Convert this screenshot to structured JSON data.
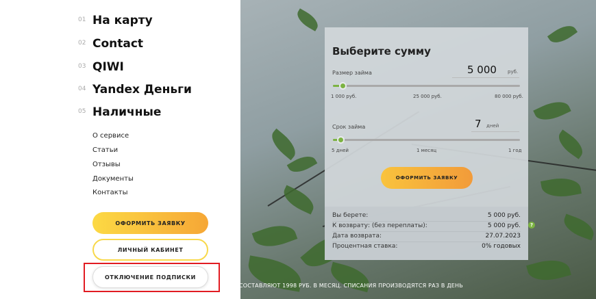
{
  "nav": {
    "items": [
      {
        "num": "01",
        "label": "На карту"
      },
      {
        "num": "02",
        "label": "Contact"
      },
      {
        "num": "03",
        "label": "QIWI"
      },
      {
        "num": "04",
        "label": "Yandex Деньги"
      },
      {
        "num": "05",
        "label": "Наличные"
      }
    ]
  },
  "links": [
    "О сервисе",
    "Статьи",
    "Отзывы",
    "Документы",
    "Контакты"
  ],
  "buttons": {
    "order": "ОФОРМИТЬ ЗАЯВКУ",
    "cabinet": "ЛИЧНЫЙ КАБИНЕТ",
    "unsubscribe": "ОТКЛЮЧЕНИЕ ПОДПИСКИ"
  },
  "calculator": {
    "title": "Выберите сумму",
    "amount": {
      "label": "Размер займа",
      "value": "5 000",
      "unit": "руб.",
      "fraction": 0.051,
      "ticks": [
        "1 000 руб.",
        "25 000 руб.",
        "80 000 руб."
      ]
    },
    "term": {
      "label": "Срок займа",
      "value": "7",
      "unit": "дней",
      "fraction": 0.04,
      "ticks": [
        "5 дней",
        "1 месяц",
        "1 год"
      ]
    },
    "submit": "ОФОРМИТЬ ЗАЯВКУ",
    "summary": [
      {
        "key": "Вы берете:",
        "value": "5 000 руб."
      },
      {
        "key": "К возврату: (без переплаты):",
        "value": "5 000 руб."
      },
      {
        "key": "Дата возврата:",
        "value": "27.07.2023"
      },
      {
        "key": "Процентная ставка:",
        "value": "0% годовых"
      }
    ],
    "help_icon": "?"
  },
  "footer_text": "СОСТАВЛЯЮТ 1998 РУБ. В МЕСЯЦ. СПИСАНИЯ ПРОИЗВОДЯТСЯ РАЗ В ДЕНЬ",
  "colors": {
    "accent": "#7cb342",
    "button": "#f9c33d",
    "highlight": "#e11b22"
  }
}
